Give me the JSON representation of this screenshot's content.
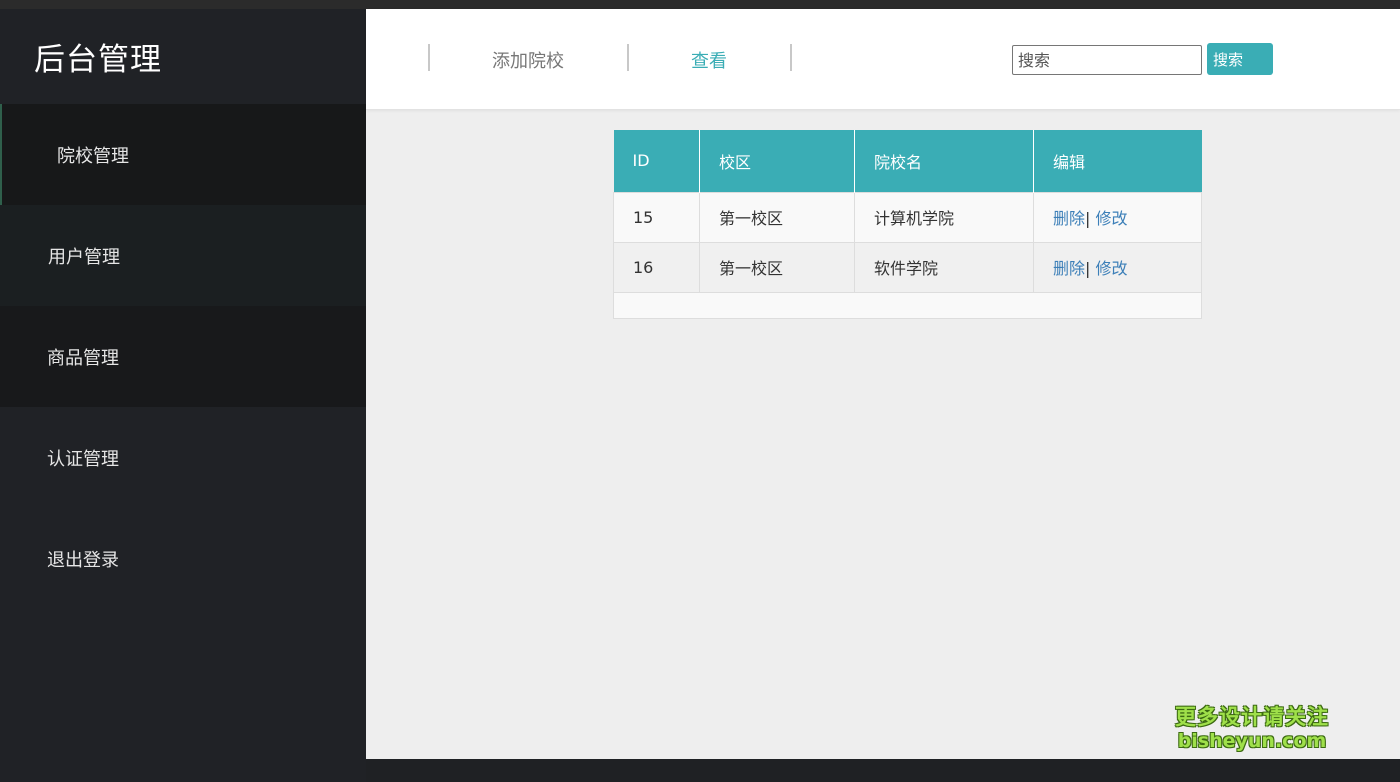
{
  "sidebar": {
    "title": "后台管理",
    "items": [
      {
        "label": "院校管理"
      },
      {
        "label": "用户管理"
      },
      {
        "label": "商品管理"
      },
      {
        "label": "认证管理"
      },
      {
        "label": "退出登录"
      }
    ]
  },
  "topbar": {
    "tabs": [
      {
        "label": "添加院校"
      },
      {
        "label": "查看"
      }
    ],
    "search": {
      "placeholder": "搜索",
      "button_label": "搜索"
    }
  },
  "table": {
    "headers": [
      "ID",
      "校区",
      "院校名",
      "编辑"
    ],
    "rows": [
      {
        "id": "15",
        "campus": "第一校区",
        "name": "计算机学院",
        "delete": "删除",
        "sep": "|",
        "edit": "修改"
      },
      {
        "id": "16",
        "campus": "第一校区",
        "name": "软件学院",
        "delete": "删除",
        "sep": "|",
        "edit": "修改"
      }
    ]
  },
  "watermark": {
    "line1": "更多设计请关注",
    "line2": "bisheyun.com"
  },
  "colors": {
    "accent": "#3aadb5",
    "sidebar": "#202226",
    "link": "#3c7fb8",
    "background": "#eeeeee"
  }
}
